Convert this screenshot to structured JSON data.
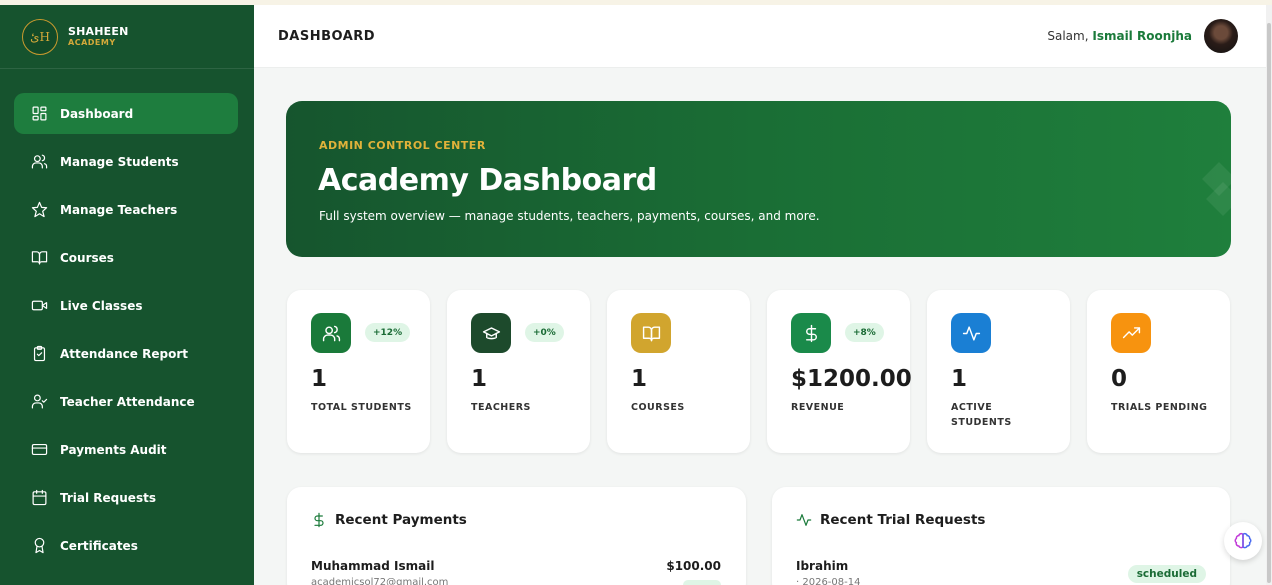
{
  "brand": {
    "name": "SHAHEEN",
    "sub": "ACADEMY",
    "logo_text": "ئH"
  },
  "sidebar": {
    "items": [
      {
        "label": "Dashboard",
        "icon": "dashboard-icon",
        "active": true
      },
      {
        "label": "Manage Students",
        "icon": "users-icon"
      },
      {
        "label": "Manage Teachers",
        "icon": "star-icon"
      },
      {
        "label": "Courses",
        "icon": "book-icon"
      },
      {
        "label": "Live Classes",
        "icon": "video-icon"
      },
      {
        "label": "Attendance Report",
        "icon": "clipboard-icon"
      },
      {
        "label": "Teacher Attendance",
        "icon": "user-check-icon"
      },
      {
        "label": "Payments Audit",
        "icon": "credit-card-icon"
      },
      {
        "label": "Trial Requests",
        "icon": "calendar-icon"
      },
      {
        "label": "Certificates",
        "icon": "award-icon"
      }
    ]
  },
  "header": {
    "title": "DASHBOARD",
    "greeting_prefix": "Salam, ",
    "user_name": "Ismail Roonjha"
  },
  "hero": {
    "eyebrow": "ADMIN CONTROL CENTER",
    "title": "Academy Dashboard",
    "subtitle": "Full system overview — manage students, teachers, payments, courses, and more."
  },
  "stats": [
    {
      "value": "1",
      "label": "TOTAL STUDENTS",
      "badge": "+12%",
      "icon": "users-icon",
      "color": "#1a7a3a"
    },
    {
      "value": "1",
      "label": "TEACHERS",
      "badge": "+0%",
      "icon": "graduation-cap-icon",
      "color": "#1d4a2c"
    },
    {
      "value": "1",
      "label": "COURSES",
      "badge": "",
      "icon": "book-open-icon",
      "color": "#d1a52e"
    },
    {
      "value": "$1200.00",
      "label": "REVENUE",
      "badge": "+8%",
      "icon": "dollar-icon",
      "color": "#1a8a4a"
    },
    {
      "value": "1",
      "label": "ACTIVE STUDENTS",
      "badge": "",
      "icon": "activity-icon",
      "color": "#1a7fd4"
    },
    {
      "value": "0",
      "label": "TRIALS PENDING",
      "badge": "",
      "icon": "trending-up-icon",
      "color": "#f7930f"
    }
  ],
  "recent_payments": {
    "title": "Recent Payments",
    "rows": [
      {
        "name": "Muhammad Ismail",
        "email": "academicsol72@gmail.com",
        "amount": "$100.00"
      }
    ]
  },
  "recent_trials": {
    "title": "Recent Trial Requests",
    "rows": [
      {
        "name": "Ibrahim",
        "date": "· 2026-08-14",
        "status": "scheduled"
      }
    ]
  }
}
